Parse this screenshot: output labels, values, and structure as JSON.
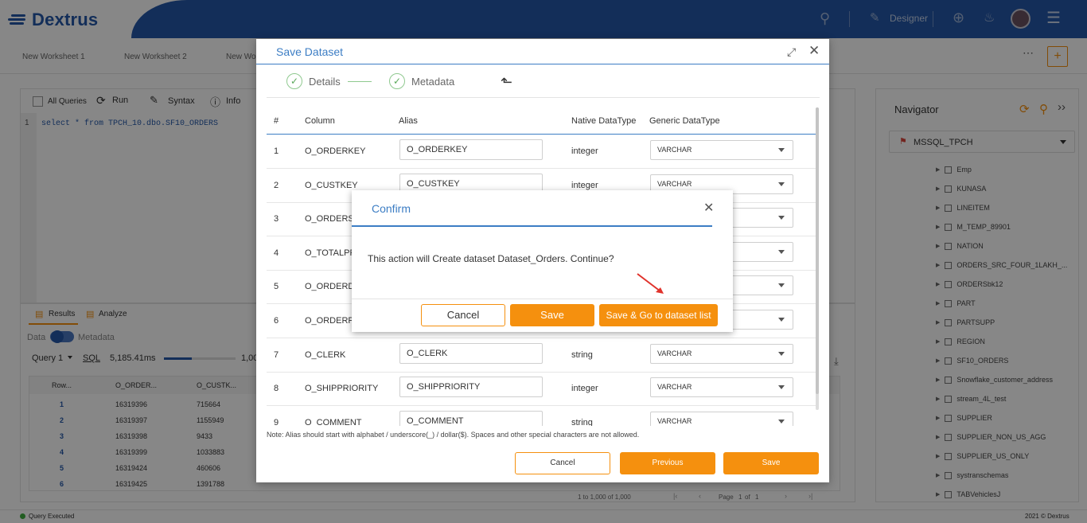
{
  "app": {
    "name": "Dextrus"
  },
  "header": {
    "designer_label": "Designer"
  },
  "worksheets": [
    "New Worksheet 1",
    "New Worksheet 2",
    "New Wo"
  ],
  "editor": {
    "all_queries": "All Queries",
    "run": "Run",
    "syntax": "Syntax",
    "info": "Info",
    "line_no": "1",
    "query": "select * from TPCH_10.dbo.SF10_ORDERS"
  },
  "results": {
    "tab_results": "Results",
    "tab_analyze": "Analyze",
    "toggle_data": "Data",
    "toggle_metadata": "Metadata",
    "query_select": "Query 1",
    "sql_link": "SQL",
    "time": "5,185.41ms",
    "count": "1,00",
    "columns": [
      "Row...",
      "O_ORDER...",
      "O_CUSTK..."
    ],
    "rows": [
      [
        "1",
        "16319396",
        "715664"
      ],
      [
        "2",
        "16319397",
        "1155949"
      ],
      [
        "3",
        "16319398",
        "9433"
      ],
      [
        "4",
        "16319399",
        "1033883"
      ],
      [
        "5",
        "16319424",
        "460606"
      ],
      [
        "6",
        "16319425",
        "1391788"
      ]
    ],
    "pagination": "1 to 1,000 of 1,000",
    "page_label": "Page",
    "page_num": "1",
    "page_of": "of",
    "page_total": "1"
  },
  "status": {
    "text": "Query Executed",
    "copyright": "2021 © Dextrus"
  },
  "navigator": {
    "title": "Navigator",
    "connection": "MSSQL_TPCH",
    "items": [
      "Emp",
      "KUNASA",
      "LINEITEM",
      "M_TEMP_89901",
      "NATION",
      "ORDERS_SRC_FOUR_1LAKH_...",
      "ORDERSbk12",
      "PART",
      "PARTSUPP",
      "REGION",
      "SF10_ORDERS",
      "Snowflake_customer_address",
      "stream_4L_test",
      "SUPPLIER",
      "SUPPLIER_NON_US_AGG",
      "SUPPLIER_US_ONLY",
      "systranschemas",
      "TABVehiclesJ"
    ]
  },
  "save_dialog": {
    "title": "Save Dataset",
    "step1": "Details",
    "step2": "Metadata",
    "headers": [
      "#",
      "Column",
      "Alias",
      "Native DataType",
      "Generic DataType"
    ],
    "rows": [
      {
        "n": "1",
        "col": "O_ORDERKEY",
        "alias": "O_ORDERKEY",
        "native": "integer",
        "generic": "VARCHAR"
      },
      {
        "n": "2",
        "col": "O_CUSTKEY",
        "alias": "O_CUSTKEY",
        "native": "integer",
        "generic": "VARCHAR"
      },
      {
        "n": "3",
        "col": "O_ORDERST",
        "alias": "",
        "native": "",
        "generic": ""
      },
      {
        "n": "4",
        "col": "O_TOTALPR",
        "alias": "",
        "native": "",
        "generic": ""
      },
      {
        "n": "5",
        "col": "O_ORDERD",
        "alias": "",
        "native": "",
        "generic": ""
      },
      {
        "n": "6",
        "col": "O_ORDERP",
        "alias": "",
        "native": "",
        "generic": ""
      },
      {
        "n": "7",
        "col": "O_CLERK",
        "alias": "O_CLERK",
        "native": "string",
        "generic": "VARCHAR"
      },
      {
        "n": "8",
        "col": "O_SHIPPRIORITY",
        "alias": "O_SHIPPRIORITY",
        "native": "integer",
        "generic": "VARCHAR"
      },
      {
        "n": "9",
        "col": "O_COMMENT",
        "alias": "O_COMMENT",
        "native": "string",
        "generic": "VARCHAR"
      }
    ],
    "note": "Note: Alias should start with alphabet / underscore(_) / dollar($). Spaces and other special characters are not allowed.",
    "cancel": "Cancel",
    "previous": "Previous",
    "save": "Save"
  },
  "confirm": {
    "title": "Confirm",
    "message": "This action will Create dataset Dataset_Orders. Continue?",
    "cancel": "Cancel",
    "save": "Save",
    "save_go": "Save & Go to dataset list"
  }
}
